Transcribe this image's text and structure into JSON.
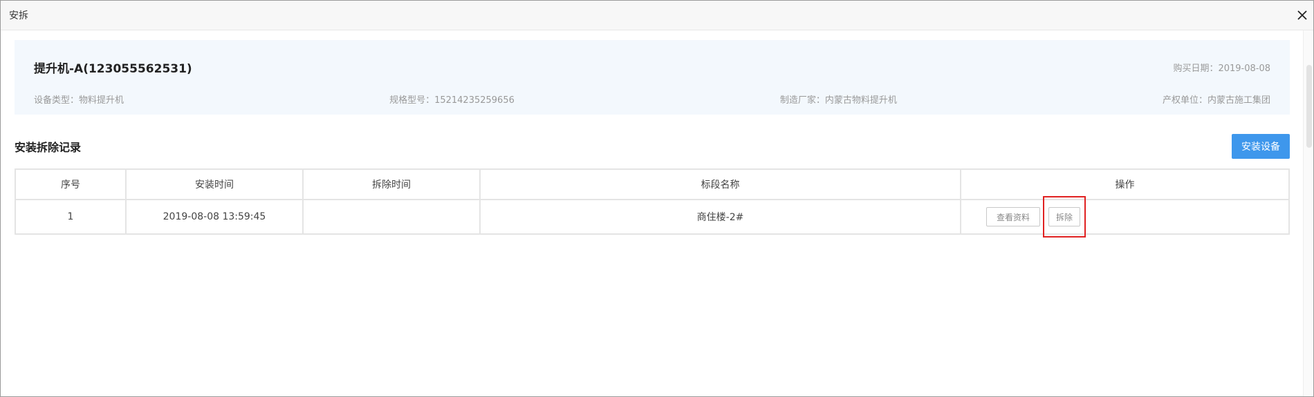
{
  "dialog": {
    "title": "安拆",
    "close_icon": "close-icon"
  },
  "device": {
    "name": "提升机-A(123055562531)",
    "purchase_date": "购买日期：2019-08-08",
    "type": "设备类型：物料提升机",
    "model": "规格型号：15214235259656",
    "manufacturer": "制造厂家：内蒙古物料提升机",
    "owner": "产权单位：内蒙古施工集团"
  },
  "records": {
    "title": "安装拆除记录",
    "install_button": "安装设备",
    "columns": [
      "序号",
      "安装时间",
      "拆除时间",
      "标段名称",
      "操作"
    ],
    "rows": [
      {
        "index": "1",
        "install_time": "2019-08-08 13:59:45",
        "remove_time": "",
        "section_name": "商住楼-2#",
        "view_button": "查看资料",
        "remove_button": "拆除"
      }
    ]
  },
  "colors": {
    "primary": "#3e97ec",
    "card_bg": "#f3f8fd",
    "highlight": "#e02020"
  }
}
